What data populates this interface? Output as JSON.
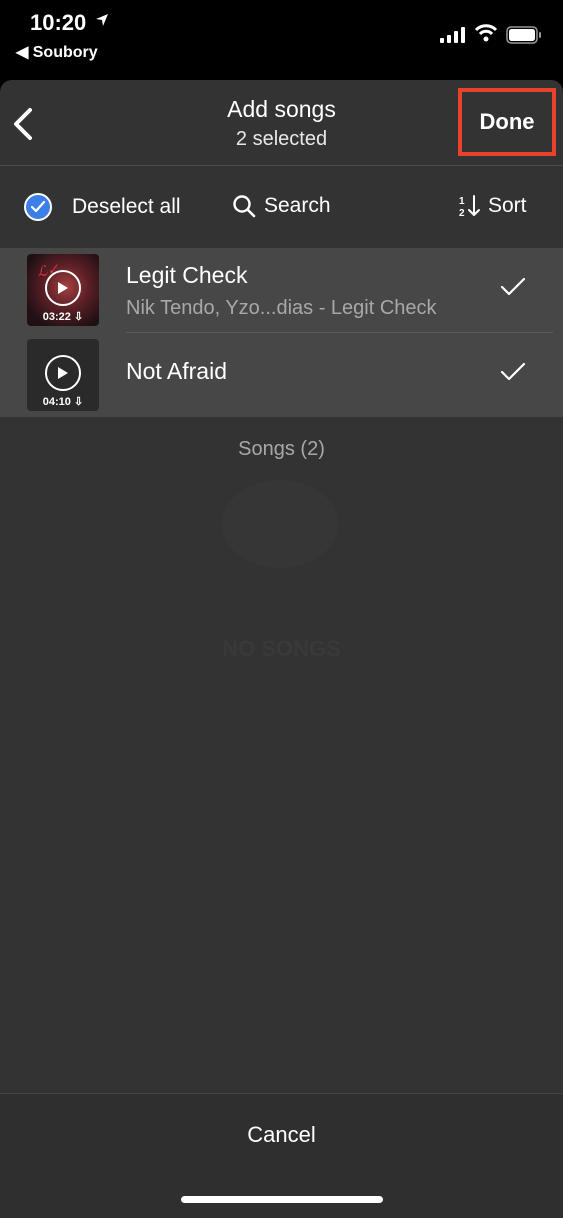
{
  "status_bar": {
    "time": "10:20",
    "back_app": "◀ Soubory"
  },
  "header": {
    "title": "Add songs",
    "subtitle": "2 selected",
    "done_label": "Done",
    "highlight_color": "#e8412c"
  },
  "toolbar": {
    "deselect_label": "Deselect all",
    "search_label": "Search",
    "sort_label": "Sort",
    "accent_color": "#3d7fe8"
  },
  "songs": [
    {
      "title": "Legit Check",
      "subtitle": "Nik Tendo, Yzo...dias - Legit Check",
      "duration": "03:22 ⇩",
      "selected": true
    },
    {
      "title": "Not Afraid",
      "subtitle": "",
      "duration": "04:10 ⇩",
      "selected": true
    }
  ],
  "songs_count_label": "Songs (2)",
  "background_ghost_text": "NO SONGS",
  "footer": {
    "cancel_label": "Cancel"
  }
}
